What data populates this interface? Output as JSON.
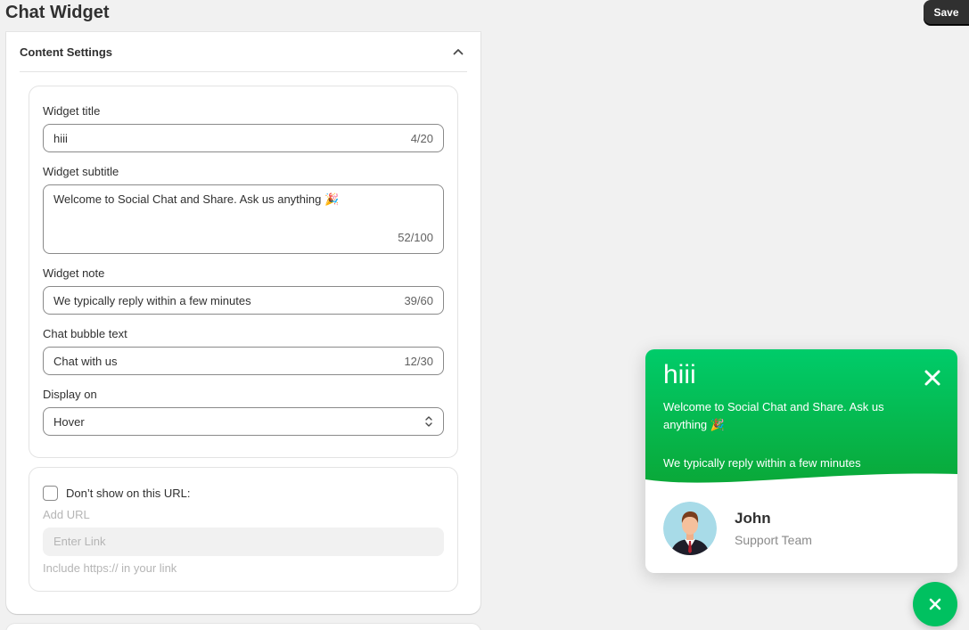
{
  "header": {
    "title": "Chat Widget",
    "save_label": "Save"
  },
  "content_settings": {
    "title": "Content Settings",
    "widget_title": {
      "label": "Widget title",
      "value": "hiii",
      "counter": "4/20"
    },
    "widget_subtitle": {
      "label": "Widget subtitle",
      "value": "Welcome to Social Chat and Share. Ask us anything 🎉",
      "counter": "52/100"
    },
    "widget_note": {
      "label": "Widget note",
      "value": "We typically reply within a few minutes",
      "counter": "39/60"
    },
    "bubble_text": {
      "label": "Chat bubble text",
      "value": "Chat with us",
      "counter": "12/30"
    },
    "display_on": {
      "label": "Display on",
      "value": "Hover"
    }
  },
  "url_exclusion": {
    "checkbox_label": "Don’t show on this URL:",
    "checked": false,
    "add_url_label": "Add URL",
    "input_placeholder": "Enter Link",
    "help_text": "Include https:// in your link"
  },
  "preview": {
    "title": "hiii",
    "subtitle": "Welcome to Social Chat and Share. Ask us anything 🎉",
    "note": "We typically reply within a few minutes",
    "agent_name": "John",
    "agent_role": "Support Team",
    "accent_color": "#00c160"
  }
}
